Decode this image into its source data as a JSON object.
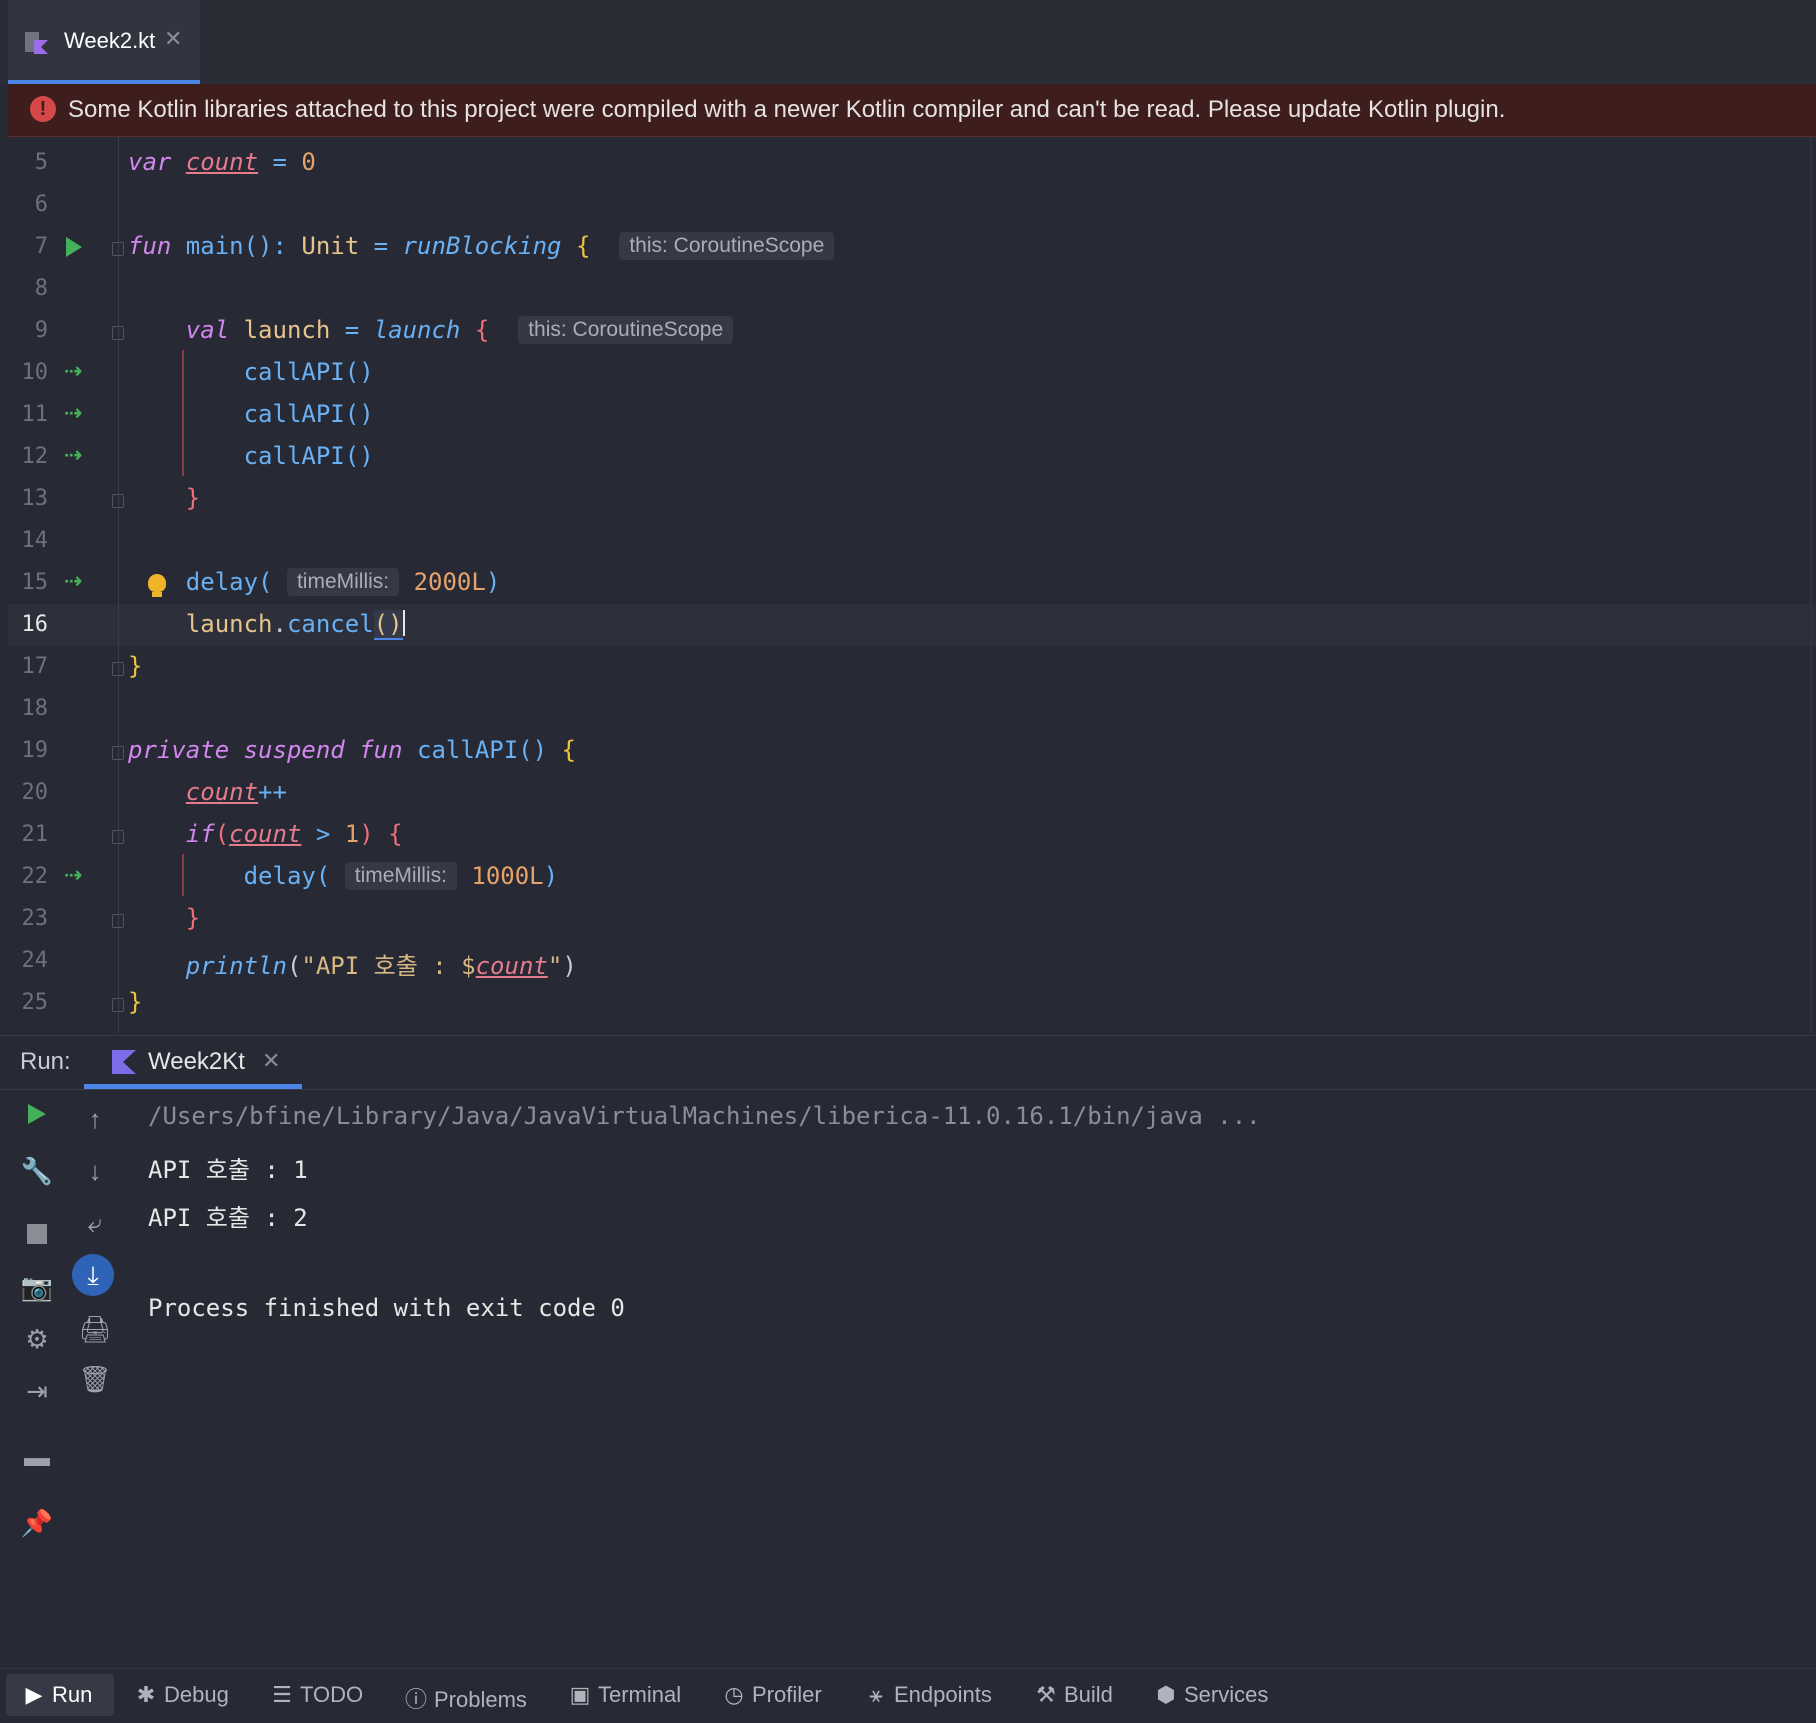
{
  "tab": {
    "title": "Week2.kt",
    "close": "✕"
  },
  "banner": {
    "text": "Some Kotlin libraries attached to this project were compiled with a newer Kotlin compiler and can't be read. Please update Kotlin plugin."
  },
  "editor": {
    "line_numbers": [
      "5",
      "6",
      "7",
      "8",
      "9",
      "10",
      "11",
      "12",
      "13",
      "14",
      "15",
      "16",
      "17",
      "18",
      "19",
      "20",
      "21",
      "22",
      "23",
      "24",
      "25"
    ],
    "current_line": "16",
    "hints": {
      "scope1": "this: CoroutineScope",
      "scope2": "this: CoroutineScope",
      "time1": "timeMillis:",
      "time2": "timeMillis:"
    },
    "code": {
      "l5_var": "var",
      "l5_count": "count",
      "l5_rest": " = ",
      "l5_zero": "0",
      "l7_fun": "fun",
      "l7_main": " main(): ",
      "l7_unit": "Unit",
      "l7_eq": " = ",
      "l7_rb": "runBlocking",
      "l7_brace": " {",
      "l9_val": "val",
      "l9_launch": " launch",
      "l9_eq": " = ",
      "l9_launchfn": "launch",
      "l9_brace": " {",
      "l10": "callAPI()",
      "l11": "callAPI()",
      "l12": "callAPI()",
      "l13": "}",
      "l15_delay": "delay(",
      "l15_val": "2000L",
      "l15_close": ")",
      "l16_launch": "launch",
      "l16_dot": ".",
      "l16_cancel": "cancel",
      "l16_parens": "()",
      "l17": "}",
      "l19_private": "private",
      "l19_suspend": "suspend",
      "l19_fun": "fun",
      "l19_name": " callAPI() ",
      "l19_brace": "{",
      "l20_count": "count",
      "l20_op": "++",
      "l21_if": "if",
      "l21_paren": "(",
      "l21_count": "count",
      "l21_rest": " > ",
      "l21_one": "1",
      "l21_close": ") ",
      "l21_brace": "{",
      "l22_delay": "delay(",
      "l22_val": "1000L",
      "l22_close": ")",
      "l23": "}",
      "l24_println": "println",
      "l24_open": "(",
      "l24_str1": "\"API 호출 : $",
      "l24_count": "count",
      "l24_str2": "\"",
      "l24_close": ")",
      "l25": "}"
    }
  },
  "run": {
    "label": "Run:",
    "tab_title": "Week2Kt",
    "tab_close": "✕",
    "console": [
      "/Users/bfine/Library/Java/JavaVirtualMachines/liberica-11.0.16.1/bin/java ...",
      "API 호출 : 1",
      "API 호출 : 2",
      "Process finished with exit code 0"
    ]
  },
  "bottombar": {
    "items": [
      "Run",
      "Debug",
      "TODO",
      "Problems",
      "Terminal",
      "Profiler",
      "Endpoints",
      "Build",
      "Services"
    ]
  },
  "colors": {
    "accent": "#4a86e8",
    "error_bg": "#3d1e1d",
    "run_green": "#44b05a"
  }
}
